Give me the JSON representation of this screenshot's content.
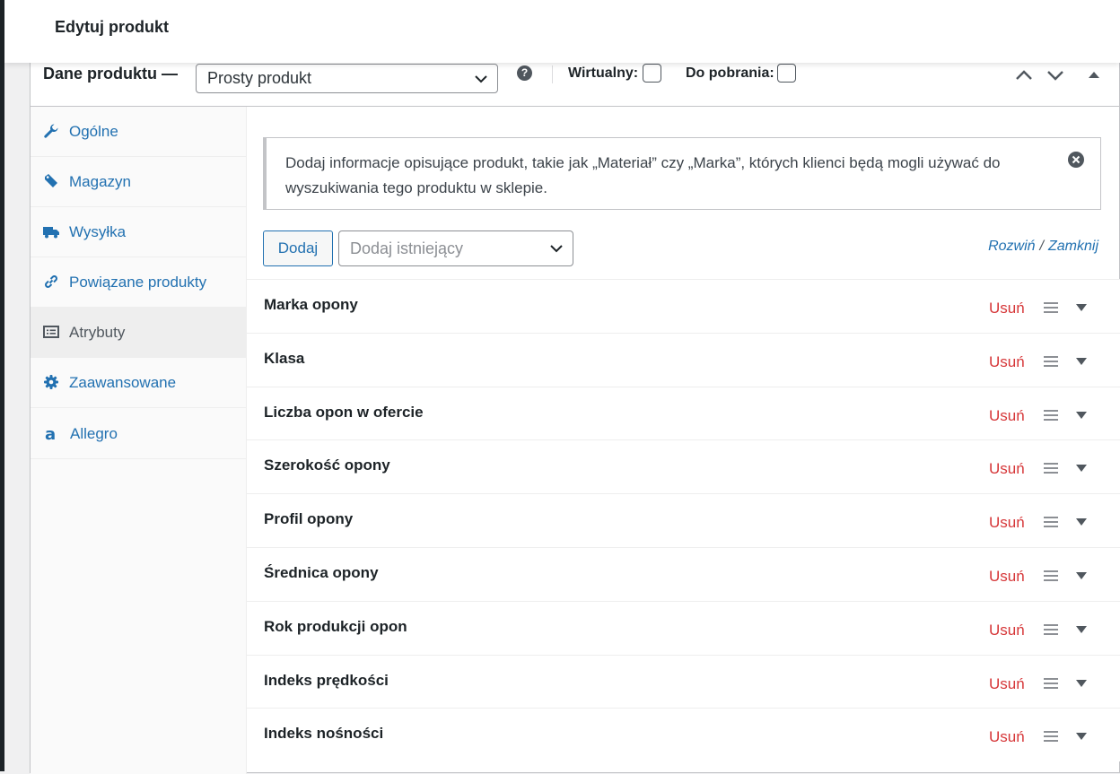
{
  "topbar": {
    "title": "Edytuj produkt"
  },
  "product_data": {
    "label": "Dane produktu —",
    "product_type": "Prosty produkt",
    "help_icon": "question-circle-icon",
    "virtual_label": "Wirtualny:",
    "downloadable_label": "Do pobrania:"
  },
  "sidebar": {
    "items": [
      {
        "label": "Ogólne",
        "icon": "wrench-icon"
      },
      {
        "label": "Magazyn",
        "icon": "tag-icon"
      },
      {
        "label": "Wysyłka",
        "icon": "truck-icon"
      },
      {
        "label": "Powiązane produkty",
        "icon": "link-icon"
      },
      {
        "label": "Atrybuty",
        "icon": "list-view-icon",
        "active": true
      },
      {
        "label": "Zaawansowane",
        "icon": "gear-icon"
      },
      {
        "label": "Allegro",
        "icon": "allegro-a-icon"
      }
    ]
  },
  "notice": {
    "text": "Dodaj informacje opisujące produkt, takie jak „Materiał” czy „Marka”, których klienci będą mogli używać do wyszukiwania tego produktu w sklepie."
  },
  "toolbar": {
    "add_label": "Dodaj",
    "existing_placeholder": "Dodaj istniejący",
    "expand_label": "Rozwiń",
    "separator": "/",
    "collapse_label": "Zamknij"
  },
  "attributes": {
    "remove_label": "Usuń",
    "items": [
      "Marka opony",
      "Klasa",
      "Liczba opon w ofercie",
      "Szerokość opony",
      "Profil opony",
      "Średnica opony",
      "Rok produkcji opon",
      "Indeks prędkości",
      "Indeks nośności"
    ]
  },
  "colors": {
    "link": "#2271b1",
    "remove": "#d63638",
    "text": "#1d2327",
    "border": "#c3c4c7",
    "background": "#f0f0f1"
  }
}
